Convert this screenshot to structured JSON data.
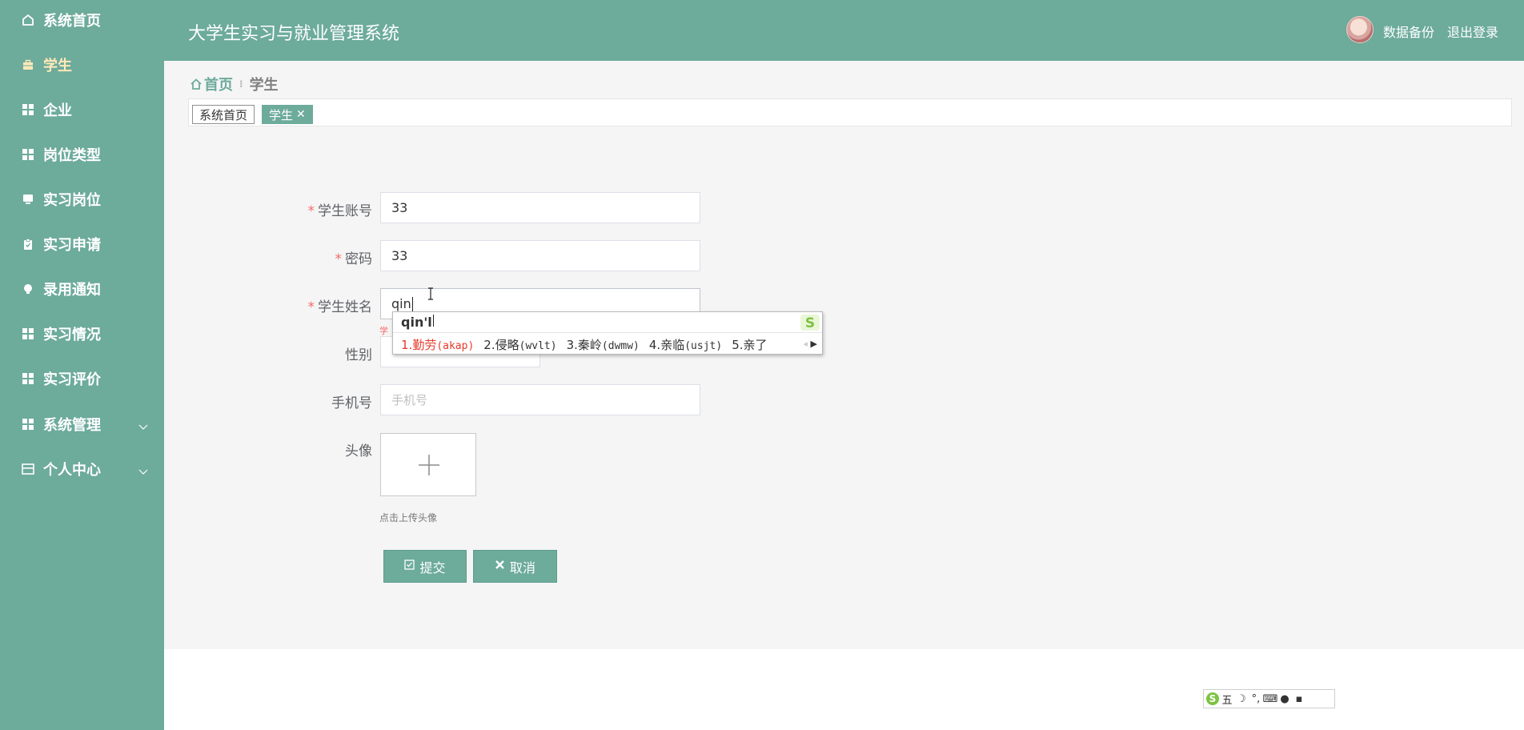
{
  "sidebar": {
    "items": [
      {
        "label": "系统首页",
        "icon": "home-icon"
      },
      {
        "label": "学生",
        "icon": "briefcase-icon",
        "active": true
      },
      {
        "label": "企业",
        "icon": "grid-icon"
      },
      {
        "label": "岗位类型",
        "icon": "grid-icon"
      },
      {
        "label": "实习岗位",
        "icon": "monitor-icon"
      },
      {
        "label": "实习申请",
        "icon": "clipboard-icon"
      },
      {
        "label": "录用通知",
        "icon": "bulb-icon"
      },
      {
        "label": "实习情况",
        "icon": "grid-icon"
      },
      {
        "label": "实习评价",
        "icon": "grid-icon"
      },
      {
        "label": "系统管理",
        "icon": "grid-icon",
        "expandable": true
      },
      {
        "label": "个人中心",
        "icon": "card-icon",
        "expandable": true
      }
    ]
  },
  "header": {
    "title": "大学生实习与就业管理系统",
    "backup_label": "数据备份",
    "logout_label": "退出登录"
  },
  "breadcrumb": {
    "home": "首页",
    "current": "学生"
  },
  "tags": {
    "home": "系统首页",
    "current": "学生",
    "close": "✕"
  },
  "form": {
    "account": {
      "label": "学生账号",
      "value": "33",
      "required": true
    },
    "password": {
      "label": "密码",
      "value": "33",
      "required": true
    },
    "name": {
      "label": "学生姓名",
      "value": "qin",
      "required": true,
      "error": "学"
    },
    "gender": {
      "label": "性别"
    },
    "phone": {
      "label": "手机号",
      "placeholder": "手机号"
    },
    "avatar": {
      "label": "头像",
      "hint": "点击上传头像"
    },
    "submit_label": "提交",
    "cancel_label": "取消"
  },
  "ime": {
    "composition": "qin'l",
    "candidates": [
      {
        "index": "1.",
        "text": "勤劳",
        "code": "(akap)"
      },
      {
        "index": "2.",
        "text": "侵略",
        "code": "(wvlt)"
      },
      {
        "index": "3.",
        "text": "秦岭",
        "code": "(dwmw)"
      },
      {
        "index": "4.",
        "text": "亲临",
        "code": "(usjt)"
      },
      {
        "index": "5.",
        "text": "亲了",
        "code": ""
      }
    ],
    "status_mode": "五"
  },
  "colors": {
    "primary": "#6dab9b",
    "active_menu": "#ffe9b8",
    "required": "#f56c6c",
    "ime_highlight": "#e53b2c"
  }
}
